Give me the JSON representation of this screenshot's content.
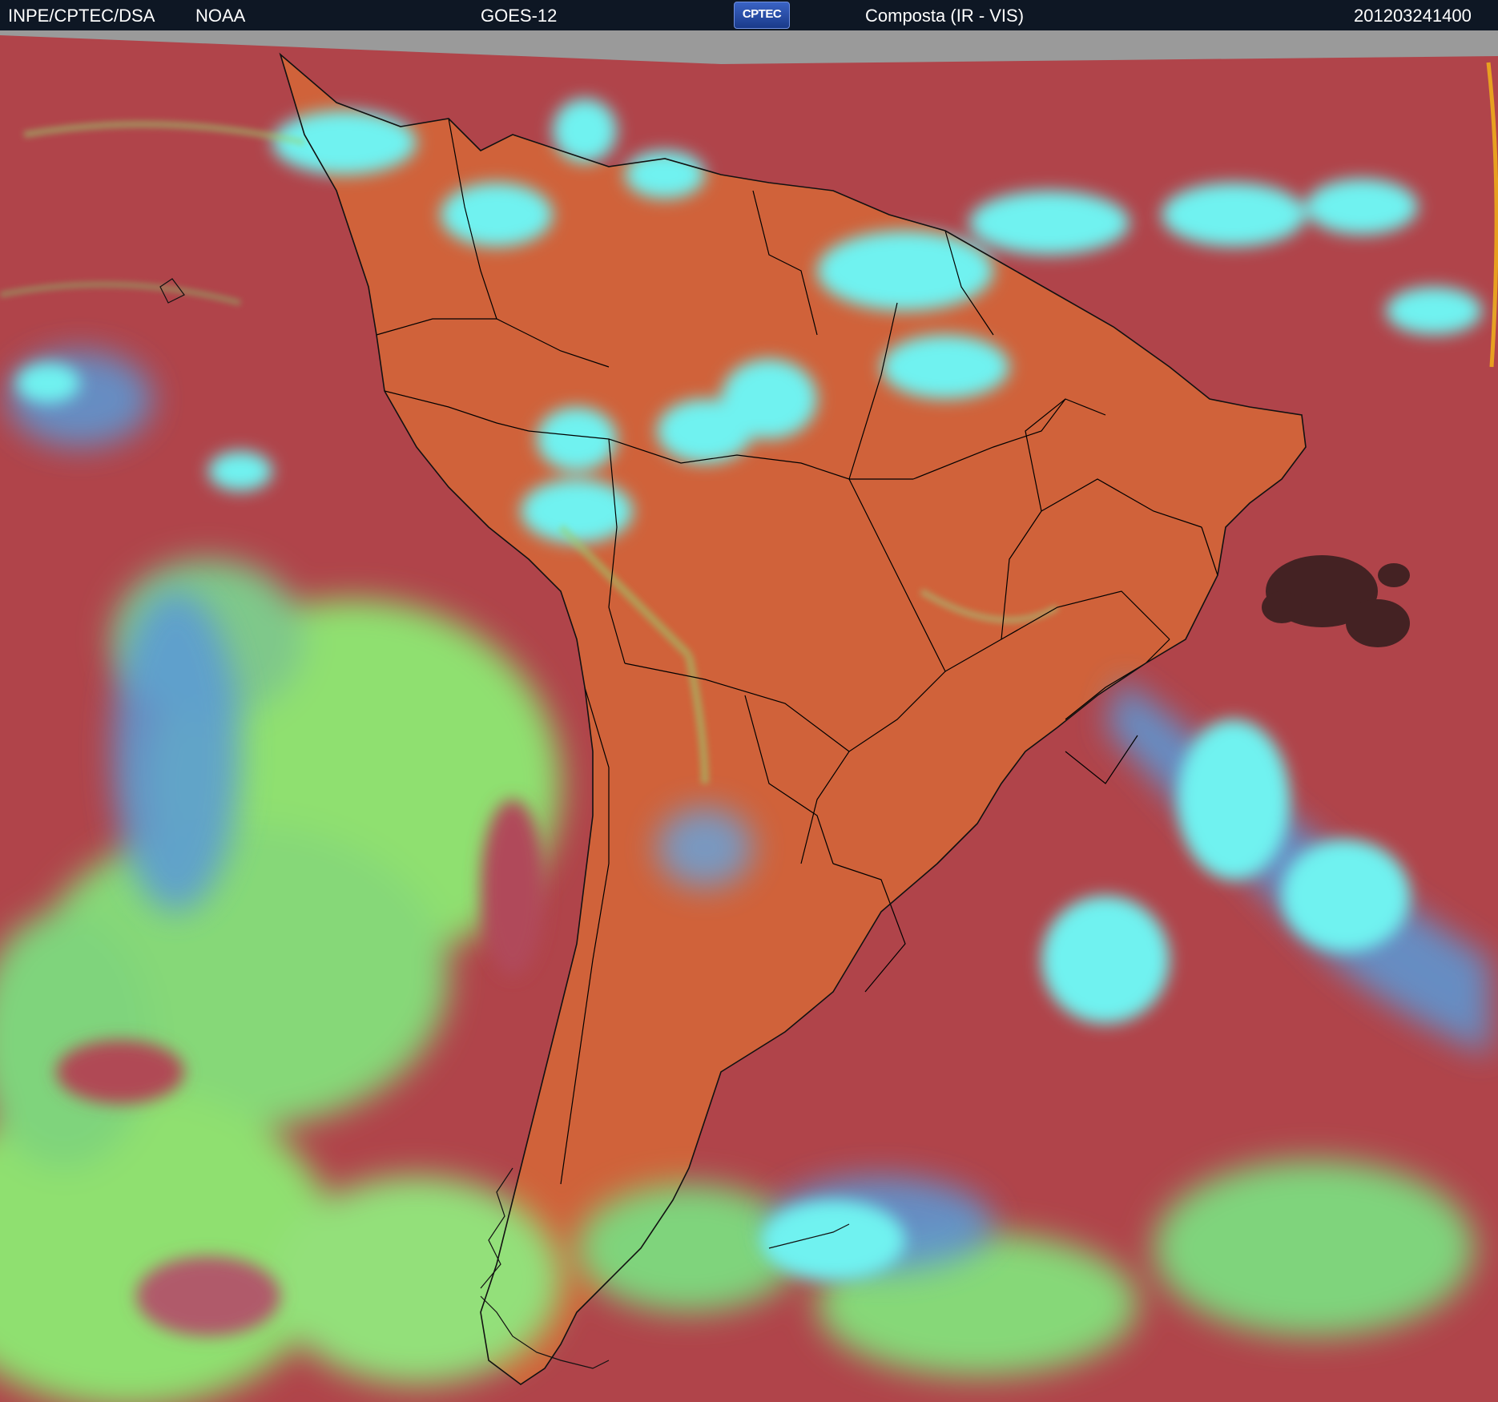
{
  "header": {
    "institution": "INPE/CPTEC/DSA",
    "agency": "NOAA",
    "satellite": "GOES-12",
    "logo_text": "CPTEC",
    "product": "Composta (IR - VIS)",
    "timestamp": "201203241400"
  },
  "colors": {
    "header_bg": "#0e1724",
    "clear_ocean": "#b0444a",
    "clear_land": "#d0623a",
    "low_cloud": "#8fe070",
    "high_cloud": "#6ff2f0",
    "mid_cloud": "#5a9ad8",
    "space": "#9a9a9a",
    "borders": "#000000"
  }
}
